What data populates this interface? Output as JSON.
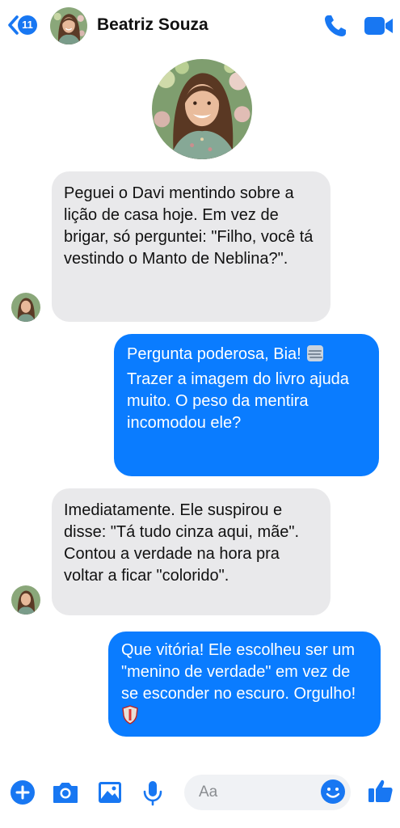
{
  "header": {
    "back_count": "11",
    "contact_name": "Beatriz Souza"
  },
  "messages": [
    {
      "direction": "incoming",
      "text": "Peguei o Davi mentindo sobre a lição de casa hoje. Em vez de brigar, só perguntei: \"Filho, você tá vestindo o Manto de Neblina?\"."
    },
    {
      "direction": "outgoing",
      "text": "Pergunta poderosa, Bia! ",
      "emoji": "fog-emoji",
      "text2": "Trazer a imagem do livro ajuda muito. O peso da mentira incomodou ele?"
    },
    {
      "direction": "incoming",
      "text": "Imediatamente. Ele suspirou e disse: \"Tá tudo cinza aqui, mãe\". Contou a verdade na hora pra voltar a ficar \"colorido\"."
    },
    {
      "direction": "outgoing",
      "text": "Que vitória! Ele escolheu ser um \"menino de verdade\" em vez de se esconder no escuro. Orgulho! ",
      "emoji": "shield-emoji"
    }
  ],
  "composer": {
    "placeholder": "Aa"
  },
  "colors": {
    "accent": "#0a7cff",
    "incoming_bubble": "#e9e9eb",
    "brand_blue": "#1877f2"
  }
}
